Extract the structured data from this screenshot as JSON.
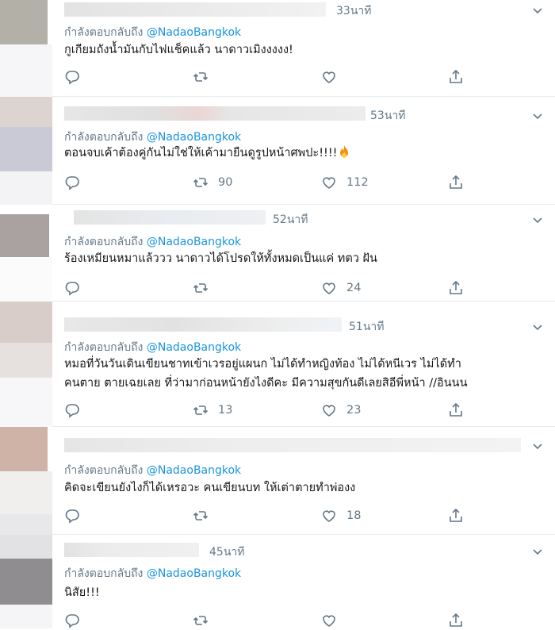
{
  "reply_prefix": "กำลังตอบกลับถึง",
  "tweets": [
    {
      "time": "33นาที",
      "handle": "@NadaoBangkok",
      "text": "กูเกียมถังน้ำมันกับไฟแช็คแล้ว นาดาวเมิงงงงง!",
      "retweets": "",
      "likes": "",
      "icons": [
        "reply-icon",
        "retweet-icon",
        "like-icon",
        "share-icon"
      ]
    },
    {
      "time": "53นาที",
      "handle": "@NadaoBangkok",
      "text": "ตอนจบเค้าต้องคู่กันไม่ใช่ให้เค้ามายืนดูรูปหน้าศพปะ!!!!",
      "retweets": "90",
      "likes": "112"
    },
    {
      "time": "52นาที",
      "handle": "@NadaoBangkok",
      "text": "ร้องเหมียนหมาแล้ววว นาดาวได้โปรดให้ทั้งหมดเป็นแค่ ทตว ฝัน",
      "retweets": "",
      "likes": "24"
    },
    {
      "time": "51นาที",
      "handle": "@NadaoBangkok",
      "text_line1": "หมอที่วันวันเดินเขียนชาทเข้าเวรอยู่แผนก ไม่ได้ทำหญิงท้อง ไม่ได้หนีเวร ไม่ได้ทำ",
      "text_line2": "คนตาย ตายเฉยเลย ที่ว่ามาก่อนหน้ายังไงดีคะ มีความสุขกันดีเลยสิอีพี่หน้า //อินนน",
      "retweets": "13",
      "likes": "23"
    },
    {
      "time": "",
      "handle": "@NadaoBangkok",
      "text": "คิดจะเขียนยังไงก็ได้เหรอวะ คนเขียนบท ให้เต่าตายทำพ่องง",
      "retweets": "",
      "likes": "18"
    },
    {
      "time": "45นาที",
      "handle": "@NadaoBangkok",
      "text": "นิสัย!!!",
      "retweets": "",
      "likes": ""
    }
  ],
  "colors": {
    "link": "#1b95e0",
    "muted": "#657786",
    "text": "#14171a",
    "divider": "#e6ecf0"
  }
}
